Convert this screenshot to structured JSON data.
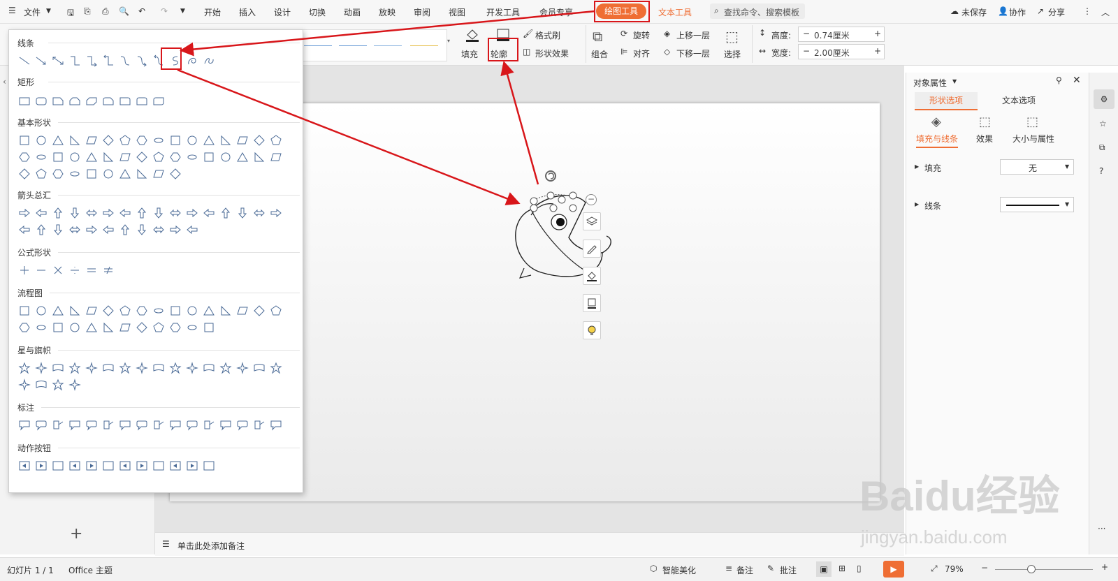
{
  "menubar": {
    "file_label": "文件",
    "tabs": [
      "开始",
      "插入",
      "设计",
      "切换",
      "动画",
      "放映",
      "审阅",
      "视图",
      "开发工具",
      "会员专享"
    ],
    "active_tab": "绘图工具",
    "text_tools_tab": "文本工具",
    "search_placeholder": "查找命令、搜索模板",
    "unsaved": "未保存",
    "collab": "协作",
    "share": "分享"
  },
  "ribbon": {
    "fill": "填充",
    "outline": "轮廓",
    "format_painter": "格式刷",
    "shape_effects": "形状效果",
    "group": "组合",
    "rotate": "旋转",
    "align": "对齐",
    "bring_forward": "上移一层",
    "send_backward": "下移一层",
    "select": "选择",
    "height_label": "高度:",
    "height_value": "0.74厘米",
    "width_label": "宽度:",
    "width_value": "2.00厘米",
    "minus": "−",
    "plus": "+"
  },
  "shape_menu": {
    "sections": [
      "线条",
      "矩形",
      "基本形状",
      "箭头总汇",
      "公式形状",
      "流程图",
      "星与旗帜",
      "标注",
      "动作按钮"
    ]
  },
  "right_panel": {
    "title": "对象属性",
    "tab_shape": "形状选项",
    "tab_text": "文本选项",
    "sub_fill_line": "填充与线条",
    "sub_effects": "效果",
    "sub_size": "大小与属性",
    "fill_label": "填充",
    "fill_value": "无",
    "line_label": "线条"
  },
  "notes": {
    "placeholder": "单击此处添加备注"
  },
  "status": {
    "slide_info": "幻灯片 1 / 1",
    "theme": "Office 主题",
    "smart": "智能美化",
    "notes": "备注",
    "comments": "批注",
    "zoom": "79%"
  },
  "watermark": {
    "brand": "Baidu经验",
    "url": "jingyan.baidu.com"
  },
  "colors": {
    "accent": "#ef6e34",
    "highlight": "#d8161a",
    "icon": "#4a6a96"
  }
}
